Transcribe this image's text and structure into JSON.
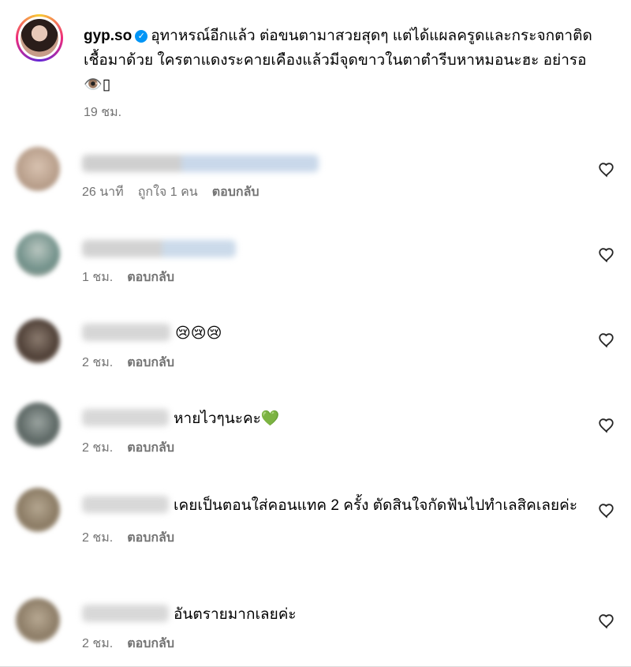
{
  "post": {
    "username": "gyp.so",
    "caption": "อุทาหรณ์อีกแล้ว ต่อขนตามาสวยสุดๆ แต่ได้แผลครูดและกระจกตาติดเชื้อมาด้วย ใครตาแดงระคายเคืองแล้วมีจุดขาวในตาตำรีบหาหมอนะฮะ อย่ารอ 👁️▯",
    "time": "19 ชม."
  },
  "comments": [
    {
      "text": "",
      "time": "26 นาที",
      "likes": "ถูกใจ 1 คน",
      "reply": "ตอบกลับ"
    },
    {
      "text": "",
      "time": "1 ชม.",
      "likes": "",
      "reply": "ตอบกลับ"
    },
    {
      "text": "😢😢😢",
      "time": "2 ชม.",
      "likes": "",
      "reply": "ตอบกลับ"
    },
    {
      "text": "หายไวๆนะคะ💚",
      "time": "2 ชม.",
      "likes": "",
      "reply": "ตอบกลับ"
    },
    {
      "text": "เคยเป็นตอนใส่คอนแทค 2 ครั้ง ตัดสินใจกัดฟันไปทำเลสิคเลยค่ะ",
      "time": "2 ชม.",
      "likes": "",
      "reply": "ตอบกลับ"
    },
    {
      "text": "อันตรายมากเลยค่ะ",
      "time": "2 ชม.",
      "likes": "",
      "reply": "ตอบกลับ"
    }
  ],
  "icons": {
    "like": "heart-outline-icon",
    "verified": "verified-badge-icon"
  },
  "colors": {
    "accent": "#0095f6",
    "meta": "#737373"
  }
}
